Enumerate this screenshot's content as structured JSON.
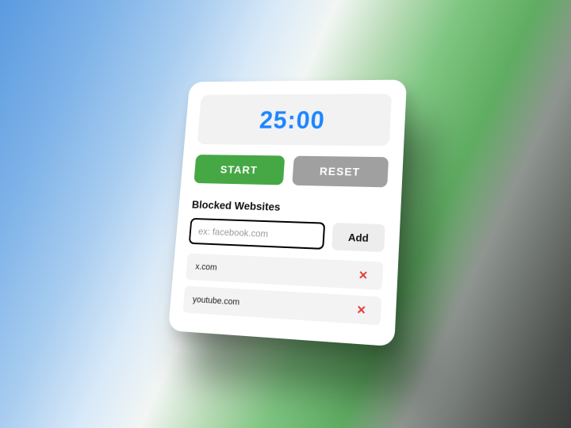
{
  "timer": {
    "display": "25:00"
  },
  "controls": {
    "start_label": "START",
    "reset_label": "RESET"
  },
  "blocked": {
    "title": "Blocked Websites",
    "input_placeholder": "ex: facebook.com",
    "input_value": "",
    "add_label": "Add",
    "items": [
      {
        "site": "x.com"
      },
      {
        "site": "youtube.com"
      }
    ]
  },
  "colors": {
    "accent_blue": "#1e86ff",
    "start_green": "#45a845",
    "reset_gray": "#a0a0a0",
    "remove_red": "#e23b3b"
  }
}
